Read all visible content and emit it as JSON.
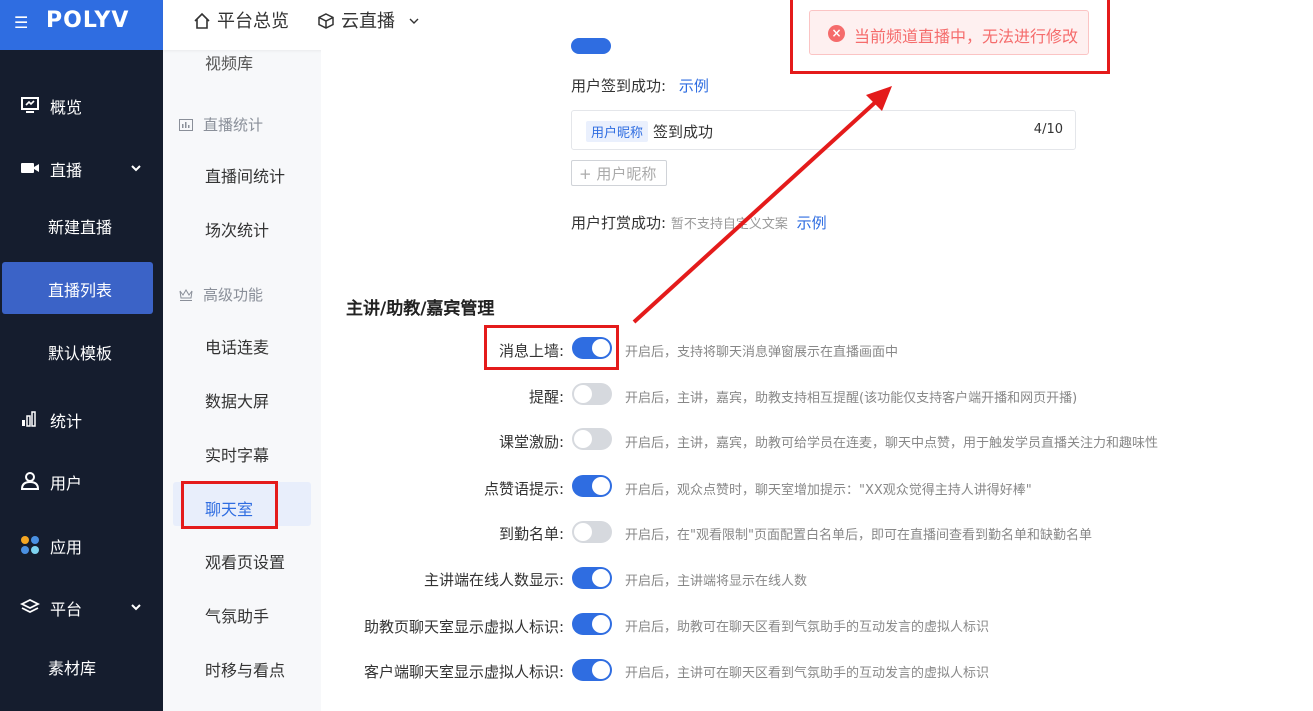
{
  "sidebar": {
    "logo": "POLYV",
    "items": [
      {
        "label": "概览",
        "icon": "monitor-icon"
      },
      {
        "label": "直播",
        "icon": "video-camera-icon"
      },
      {
        "label": "新建直播"
      },
      {
        "label": "直播列表"
      },
      {
        "label": "默认模板"
      },
      {
        "label": "统计",
        "icon": "bar-chart-icon"
      },
      {
        "label": "用户",
        "icon": "user-icon"
      },
      {
        "label": "应用",
        "icon": "apps-icon"
      },
      {
        "label": "平台",
        "icon": "layers-icon"
      },
      {
        "label": "素材库"
      }
    ]
  },
  "subnav": {
    "cut_top": "视频库",
    "group1": "直播统计",
    "items1": [
      "直播间统计",
      "场次统计"
    ],
    "group2": "高级功能",
    "items2": [
      "电话连麦",
      "数据大屏",
      "实时字幕",
      "聊天室",
      "观看页设置",
      "气氛助手",
      "时移与看点"
    ]
  },
  "topbar": {
    "home": "平台总览",
    "live": "云直播"
  },
  "toast": {
    "text": "当前频道直播中，无法进行修改"
  },
  "checkin": {
    "label": "用户签到成功:",
    "example": "示例",
    "tag": "用户昵称",
    "message": "签到成功",
    "counter": "4/10",
    "add": "+ 用户昵称"
  },
  "reward": {
    "label": "用户打赏成功:",
    "note": "暂不支持自定义文案",
    "example": "示例"
  },
  "section": {
    "title": "主讲/助教/嘉宾管理"
  },
  "settings": [
    {
      "label": "消息上墙:",
      "on": true,
      "desc": "开启后，支持将聊天消息弹窗展示在直播画面中"
    },
    {
      "label": "提醒:",
      "on": false,
      "desc": "开启后，主讲，嘉宾，助教支持相互提醒(该功能仅支持客户端开播和网页开播)"
    },
    {
      "label": "课堂激励:",
      "on": false,
      "desc": "开启后，主讲，嘉宾，助教可给学员在连麦，聊天中点赞，用于触发学员直播关注力和趣味性"
    },
    {
      "label": "点赞语提示:",
      "on": true,
      "desc": "开启后，观众点赞时，聊天室增加提示：\"XX观众觉得主持人讲得好棒\""
    },
    {
      "label": "到勤名单:",
      "on": false,
      "desc": "开启后，在\"观看限制\"页面配置白名单后，即可在直播间查看到勤名单和缺勤名单"
    },
    {
      "label": "主讲端在线人数显示:",
      "on": true,
      "desc": "开启后，主讲端将显示在线人数"
    },
    {
      "label": "助教页聊天室显示虚拟人标识:",
      "on": true,
      "desc": "开启后，助教可在聊天区看到气氛助手的互动发言的虚拟人标识"
    },
    {
      "label": "客户端聊天室显示虚拟人标识:",
      "on": true,
      "desc": "开启后，主讲可在聊天区看到气氛助手的互动发言的虚拟人标识"
    }
  ],
  "colors": {
    "accent": "#2f6de1",
    "sidebar": "#151d2e",
    "highlight": "#e41b1b",
    "error": "#f56c6c"
  }
}
